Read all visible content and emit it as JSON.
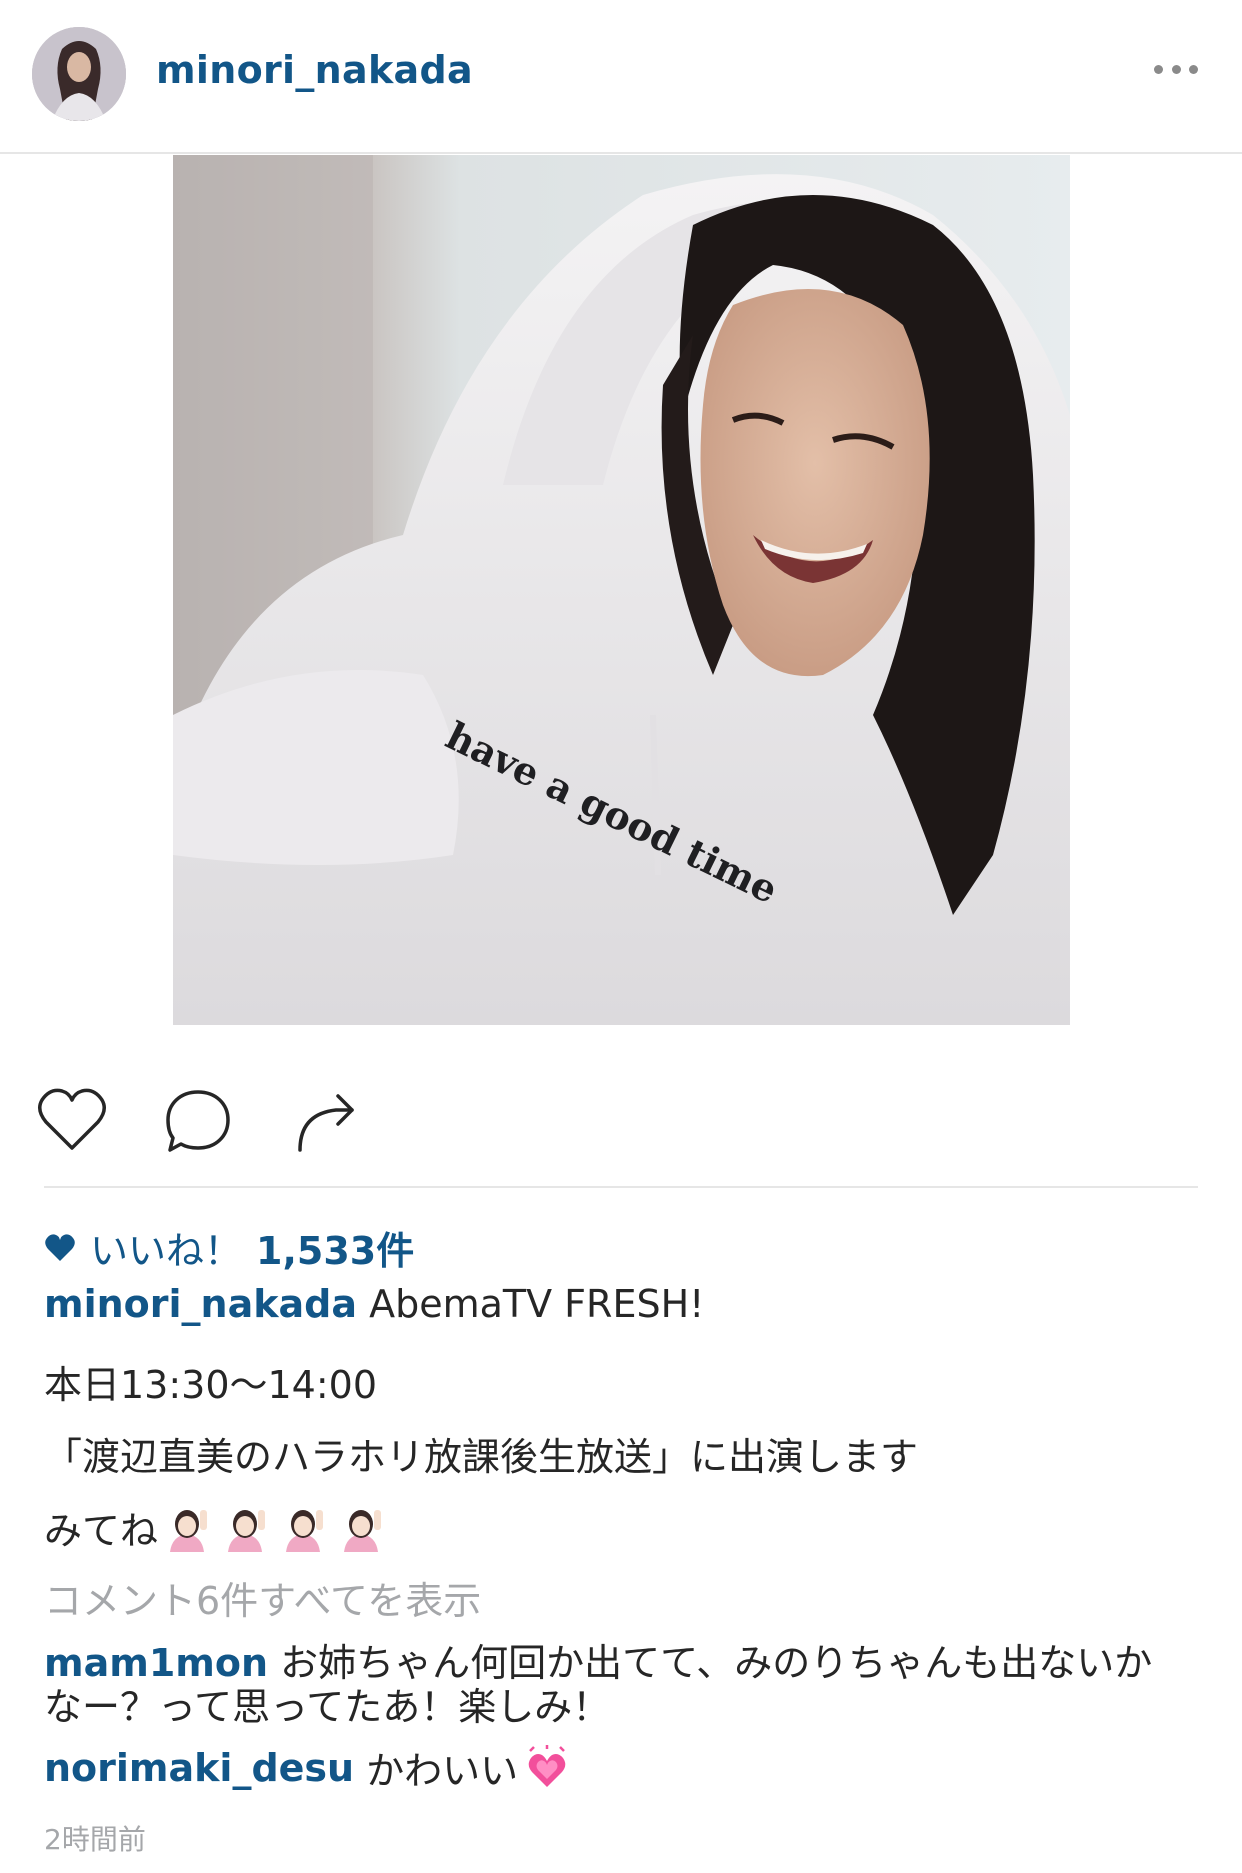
{
  "post": {
    "username": "minori_nakada",
    "photo_shirt_text": "have a good time",
    "likes_label": "いいね！",
    "likes_count": "1,533件",
    "caption": {
      "username": "minori_nakada",
      "line1": "AbemaTV FRESH!",
      "line2": "本日13:30〜14:00",
      "line3": "「渡辺直美のハラホリ放課後生放送」に出演します",
      "line4": "みてね"
    },
    "view_all_comments": "コメント6件すべてを表示",
    "comments": [
      {
        "username": "mam1mon",
        "text_line1": "お姉ちゃん何回か出てて、みのりちゃんも出ないか",
        "text_line2": "なー？って思ってたあ！楽しみ！"
      },
      {
        "username": "norimaki_desu",
        "text": "かわいい"
      }
    ],
    "timestamp": "2時間前"
  },
  "colors": {
    "link": "#125688",
    "text": "#262626",
    "muted": "#a5a7aa",
    "divider": "#e6e6e6"
  },
  "icons": {
    "like": "heart-outline-icon",
    "comment": "speech-bubble-icon",
    "share": "share-arrow-icon",
    "more": "ellipsis-icon",
    "likes_heart": "heart-filled-icon",
    "emoji_caption": "person-raising-hand-emoji",
    "emoji_comment": "growing-heart-emoji"
  }
}
